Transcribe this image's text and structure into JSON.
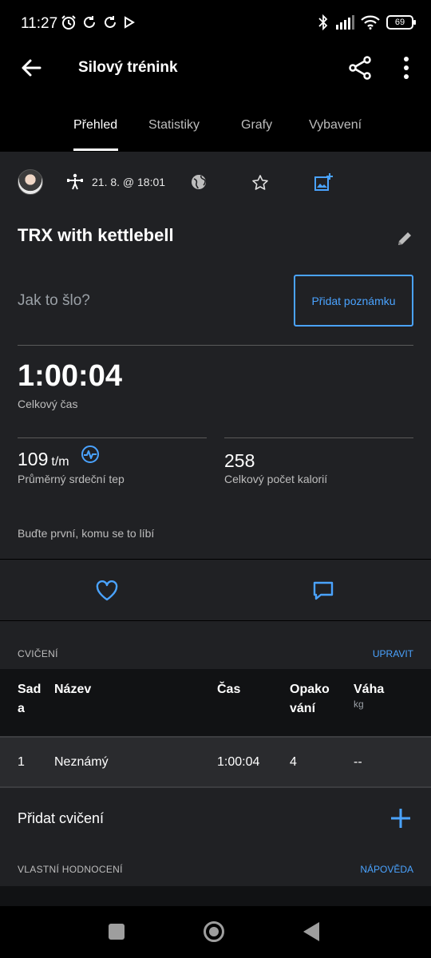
{
  "status_bar": {
    "time": "11:27",
    "battery": "69",
    "icons_left": [
      "alarm-icon",
      "sync-icon",
      "sync-icon",
      "play-store-icon"
    ],
    "icons_right": [
      "bluetooth-icon",
      "signal-icon",
      "wifi-icon",
      "battery-icon"
    ]
  },
  "app_bar": {
    "title": "Silový trénink",
    "icons": [
      "back-arrow-icon",
      "share-icon",
      "more-vert-icon"
    ]
  },
  "tabs": [
    {
      "label": "Přehled",
      "active": true
    },
    {
      "label": "Statistiky",
      "active": false
    },
    {
      "label": "Grafy",
      "active": false
    },
    {
      "label": "Vybavení",
      "active": false
    }
  ],
  "meta": {
    "date": "21. 8. @ 18:01",
    "icons": [
      "avatar",
      "strength-activity-icon",
      "globe-icon",
      "star-icon",
      "add-photo-icon"
    ]
  },
  "workout": {
    "name": "TRX with kettlebell",
    "note_prompt": "Jak to šlo?",
    "note_button": "Přidat poznámku"
  },
  "stats": {
    "total_time": "1:00:04",
    "total_time_label": "Celkový čas",
    "heart_rate_value": "109",
    "heart_rate_unit": "t/m",
    "heart_rate_label": "Průměrný srdeční tep",
    "calories_value": "258",
    "calories_label": "Celkový počet kalorií"
  },
  "social": {
    "likes_text": "Buďte první, komu se to líbí",
    "icons": [
      "heart-icon",
      "comment-icon"
    ]
  },
  "exercises": {
    "section_title": "CVIČENÍ",
    "section_link": "UPRAVIT",
    "columns": [
      {
        "label": "Sad\na",
        "sub": ""
      },
      {
        "label": "Název",
        "sub": ""
      },
      {
        "label": "Čas",
        "sub": ""
      },
      {
        "label": "Opako\nvání",
        "sub": ""
      },
      {
        "label": "Váha",
        "sub": "kg"
      }
    ],
    "rows": [
      [
        "1",
        "Neznámý",
        "1:00:04",
        "4",
        "--"
      ]
    ],
    "add_label": "Přidat cvičení"
  },
  "rating": {
    "section_title": "VLASTNÍ HODNOCENÍ",
    "section_link": "NÁPOVĚDA"
  },
  "colors": {
    "accent": "#4aa3ff",
    "background": "#202124",
    "header": "#000000"
  }
}
